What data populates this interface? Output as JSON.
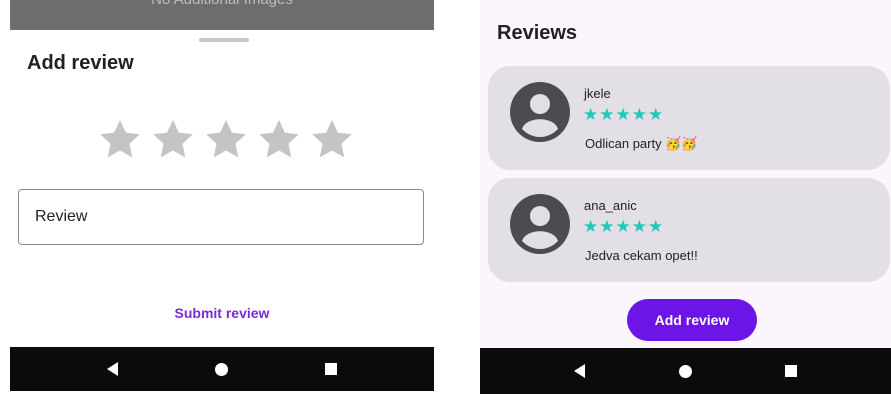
{
  "add_review_screen": {
    "background_hint_text": "No Additional Images",
    "title": "Add review",
    "rating": {
      "max_stars": 5,
      "selected": 0,
      "empty_color": "#c4c4c4"
    },
    "review_field": {
      "placeholder": "Review",
      "value": ""
    },
    "submit_label": "Submit review",
    "submit_color": "#7a2bd8"
  },
  "reviews_screen": {
    "title": "Reviews",
    "reviews": [
      {
        "username": "jkele",
        "stars": "★★★★★",
        "rating": 5,
        "comment": "Odlican party 🥳🥳"
      },
      {
        "username": "ana_anic",
        "stars": "★★★★★",
        "rating": 5,
        "comment": "Jedva cekam opet!!"
      }
    ],
    "add_review_label": "Add review",
    "star_color": "#1fc9b8",
    "accent_color": "#6d14e6"
  },
  "nav_bar": {
    "back_icon": "back-triangle-icon",
    "home_icon": "home-circle-icon",
    "recents_icon": "recents-square-icon"
  }
}
